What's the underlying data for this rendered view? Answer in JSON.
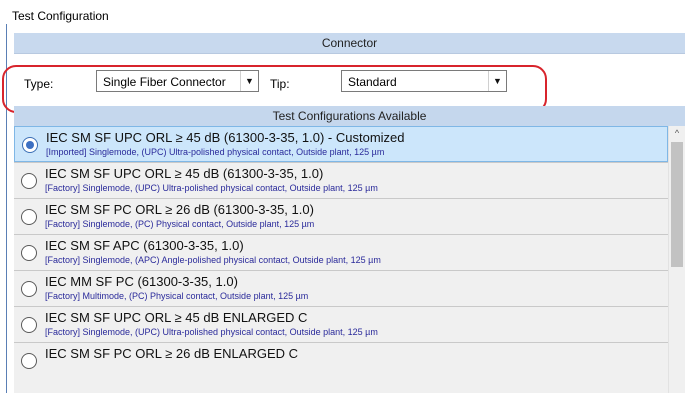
{
  "window": {
    "title": "Test Configuration"
  },
  "connector": {
    "header": "Connector",
    "type_label": "Type:",
    "type_value": "Single Fiber Connector",
    "tip_label": "Tip:",
    "tip_value": "Standard"
  },
  "tests": {
    "header": "Test Configurations Available",
    "selected_index": 0,
    "items": [
      {
        "title": "IEC SM SF UPC ORL ≥ 45 dB (61300-3-35, 1.0) - Customized",
        "detail": "[Imported] Singlemode, (UPC) Ultra-polished physical contact, Outside plant, 125 µm"
      },
      {
        "title": "IEC SM SF UPC ORL ≥ 45 dB (61300-3-35, 1.0)",
        "detail": "[Factory] Singlemode, (UPC) Ultra-polished physical contact, Outside plant, 125 µm"
      },
      {
        "title": "IEC SM SF PC ORL ≥ 26 dB (61300-3-35, 1.0)",
        "detail": "[Factory] Singlemode, (PC) Physical contact, Outside plant, 125 µm"
      },
      {
        "title": "IEC SM SF APC (61300-3-35, 1.0)",
        "detail": "[Factory] Singlemode, (APC) Angle-polished physical contact, Outside plant, 125 µm"
      },
      {
        "title": "IEC MM SF PC (61300-3-35, 1.0)",
        "detail": "[Factory] Multimode, (PC) Physical contact, Outside plant, 125 µm"
      },
      {
        "title": "IEC SM SF UPC ORL ≥ 45 dB ENLARGED C",
        "detail": "[Factory] Singlemode, (UPC) Ultra-polished physical contact, Outside plant, 125 µm"
      },
      {
        "title": "IEC SM SF PC ORL ≥ 26 dB ENLARGED C",
        "detail": ""
      }
    ]
  },
  "icons": {
    "dropdown": "chevron-down-icon",
    "scroll_up": "scroll-up-arrow-icon"
  },
  "colors": {
    "header_bg": "#c8d9ee",
    "selected_row_bg": "#cce6fb",
    "detail_text": "#2a2a9a",
    "highlight_oval": "#d8242c"
  }
}
